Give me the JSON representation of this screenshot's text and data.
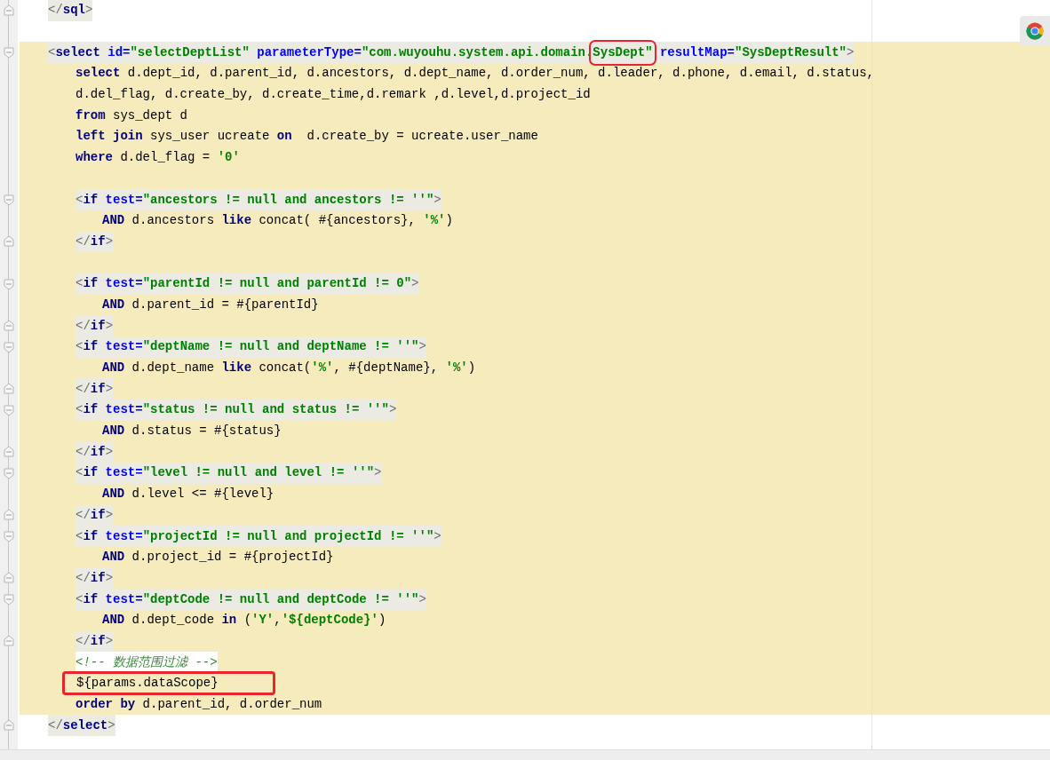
{
  "prev_block_close": {
    "tokens": [
      {
        "kind": "bracket",
        "t": "</"
      },
      {
        "kind": "tag",
        "t": "sql"
      },
      {
        "kind": "bracket",
        "t": ">"
      }
    ]
  },
  "select_block": {
    "open": {
      "tokens": [
        {
          "kind": "bracket",
          "t": "<"
        },
        {
          "kind": "tag",
          "t": "select"
        },
        {
          "kind": "attr",
          "t": " id="
        },
        {
          "kind": "value",
          "t": "\"selectDeptList\""
        },
        {
          "kind": "attr",
          "t": " parameterType="
        },
        {
          "kind": "value",
          "t": "\"com.wuyouhu.system.api.domain."
        },
        {
          "kind": "value",
          "t": "SysDept\"",
          "highlight": true
        },
        {
          "kind": "attr",
          "t": " resultMap="
        },
        {
          "kind": "value",
          "t": "\"SysDeptResult\""
        },
        {
          "kind": "bracket",
          "t": ">"
        }
      ]
    },
    "body": [
      {
        "kind": "line",
        "tokens": [
          {
            "kind": "keyword",
            "t": "select"
          },
          {
            "kind": "plain",
            "t": " d.dept_id, d.parent_id, d.ancestors, d.dept_name, d.order_num, d.leader, d.phone, d.email, d.status,"
          }
        ]
      },
      {
        "kind": "line",
        "tokens": [
          {
            "kind": "plain",
            "t": "d.del_flag, d.create_by, d.create_time,d.remark ,d.level,d.project_id"
          }
        ]
      },
      {
        "kind": "line",
        "tokens": [
          {
            "kind": "keyword",
            "t": "from"
          },
          {
            "kind": "plain",
            "t": " sys_dept d"
          }
        ]
      },
      {
        "kind": "line",
        "tokens": [
          {
            "kind": "keyword",
            "t": "left join"
          },
          {
            "kind": "plain",
            "t": " sys_user ucreate "
          },
          {
            "kind": "keyword",
            "t": "on"
          },
          {
            "kind": "plain",
            "t": "  d.create_by = ucreate.user_name"
          }
        ]
      },
      {
        "kind": "line",
        "tokens": [
          {
            "kind": "keyword",
            "t": "where"
          },
          {
            "kind": "plain",
            "t": " d.del_flag = "
          },
          {
            "kind": "literal",
            "t": "'0'"
          }
        ]
      },
      {
        "kind": "blank"
      },
      {
        "kind": "if",
        "open": [
          {
            "kind": "bracket",
            "t": "<"
          },
          {
            "kind": "tag",
            "t": "if"
          },
          {
            "kind": "attr",
            "t": " test="
          },
          {
            "kind": "value",
            "t": "\"ancestors != null and ancestors != ''\""
          },
          {
            "kind": "bracket",
            "t": ">"
          }
        ],
        "body": [
          {
            "kind": "line",
            "tokens": [
              {
                "kind": "keyword",
                "t": "AND"
              },
              {
                "kind": "plain",
                "t": " d.ancestors "
              },
              {
                "kind": "keyword",
                "t": "like"
              },
              {
                "kind": "plain",
                "t": " concat( #{ancestors}, "
              },
              {
                "kind": "literal",
                "t": "'%'"
              },
              {
                "kind": "plain",
                "t": ")"
              }
            ]
          }
        ],
        "close": [
          {
            "kind": "bracket",
            "t": "</"
          },
          {
            "kind": "tag",
            "t": "if"
          },
          {
            "kind": "bracket",
            "t": ">"
          }
        ]
      },
      {
        "kind": "blank"
      },
      {
        "kind": "if",
        "open": [
          {
            "kind": "bracket",
            "t": "<"
          },
          {
            "kind": "tag",
            "t": "if"
          },
          {
            "kind": "attr",
            "t": " test="
          },
          {
            "kind": "value",
            "t": "\"parentId != null and parentId != 0\""
          },
          {
            "kind": "bracket",
            "t": ">"
          }
        ],
        "body": [
          {
            "kind": "line",
            "tokens": [
              {
                "kind": "keyword",
                "t": "AND"
              },
              {
                "kind": "plain",
                "t": " d.parent_id = #{parentId}"
              }
            ]
          }
        ],
        "close": [
          {
            "kind": "bracket",
            "t": "</"
          },
          {
            "kind": "tag",
            "t": "if"
          },
          {
            "kind": "bracket",
            "t": ">"
          }
        ]
      },
      {
        "kind": "if",
        "open": [
          {
            "kind": "bracket",
            "t": "<"
          },
          {
            "kind": "tag",
            "t": "if"
          },
          {
            "kind": "attr",
            "t": " test="
          },
          {
            "kind": "value",
            "t": "\"deptName != null and deptName != ''\""
          },
          {
            "kind": "bracket",
            "t": ">"
          }
        ],
        "body": [
          {
            "kind": "line",
            "tokens": [
              {
                "kind": "keyword",
                "t": "AND"
              },
              {
                "kind": "plain",
                "t": " d.dept_name "
              },
              {
                "kind": "keyword",
                "t": "like"
              },
              {
                "kind": "plain",
                "t": " concat("
              },
              {
                "kind": "literal",
                "t": "'%'"
              },
              {
                "kind": "plain",
                "t": ", #{deptName}, "
              },
              {
                "kind": "literal",
                "t": "'%'"
              },
              {
                "kind": "plain",
                "t": ")"
              }
            ]
          }
        ],
        "close": [
          {
            "kind": "bracket",
            "t": "</"
          },
          {
            "kind": "tag",
            "t": "if"
          },
          {
            "kind": "bracket",
            "t": ">"
          }
        ]
      },
      {
        "kind": "if",
        "open": [
          {
            "kind": "bracket",
            "t": "<"
          },
          {
            "kind": "tag",
            "t": "if"
          },
          {
            "kind": "attr",
            "t": " test="
          },
          {
            "kind": "value",
            "t": "\"status != null and status != ''\""
          },
          {
            "kind": "bracket",
            "t": ">"
          }
        ],
        "body": [
          {
            "kind": "line",
            "tokens": [
              {
                "kind": "keyword",
                "t": "AND"
              },
              {
                "kind": "plain",
                "t": " d.status = #{status}"
              }
            ]
          }
        ],
        "close": [
          {
            "kind": "bracket",
            "t": "</"
          },
          {
            "kind": "tag",
            "t": "if"
          },
          {
            "kind": "bracket",
            "t": ">"
          }
        ]
      },
      {
        "kind": "if",
        "open": [
          {
            "kind": "bracket",
            "t": "<"
          },
          {
            "kind": "tag",
            "t": "if"
          },
          {
            "kind": "attr",
            "t": " test="
          },
          {
            "kind": "value",
            "t": "\"level != null and level != ''\""
          },
          {
            "kind": "bracket",
            "t": ">"
          }
        ],
        "body": [
          {
            "kind": "line",
            "tokens": [
              {
                "kind": "keyword",
                "t": "AND"
              },
              {
                "kind": "plain",
                "t": " d.level <= #{level}"
              }
            ]
          }
        ],
        "close": [
          {
            "kind": "bracket",
            "t": "</"
          },
          {
            "kind": "tag",
            "t": "if"
          },
          {
            "kind": "bracket",
            "t": ">"
          }
        ]
      },
      {
        "kind": "if",
        "open": [
          {
            "kind": "bracket",
            "t": "<"
          },
          {
            "kind": "tag",
            "t": "if"
          },
          {
            "kind": "attr",
            "t": " test="
          },
          {
            "kind": "value",
            "t": "\"projectId != null and projectId != ''\""
          },
          {
            "kind": "bracket",
            "t": ">"
          }
        ],
        "body": [
          {
            "kind": "line",
            "tokens": [
              {
                "kind": "keyword",
                "t": "AND"
              },
              {
                "kind": "plain",
                "t": " d.project_id = #{projectId}"
              }
            ]
          }
        ],
        "close": [
          {
            "kind": "bracket",
            "t": "</"
          },
          {
            "kind": "tag",
            "t": "if"
          },
          {
            "kind": "bracket",
            "t": ">"
          }
        ]
      },
      {
        "kind": "if",
        "open": [
          {
            "kind": "bracket",
            "t": "<"
          },
          {
            "kind": "tag",
            "t": "if"
          },
          {
            "kind": "attr",
            "t": " test="
          },
          {
            "kind": "value",
            "t": "\"deptCode != null and deptCode != ''\""
          },
          {
            "kind": "bracket",
            "t": ">"
          }
        ],
        "body": [
          {
            "kind": "line",
            "tokens": [
              {
                "kind": "keyword",
                "t": "AND"
              },
              {
                "kind": "plain",
                "t": " d.dept_code "
              },
              {
                "kind": "keyword",
                "t": "in"
              },
              {
                "kind": "plain",
                "t": " ("
              },
              {
                "kind": "literal",
                "t": "'Y'"
              },
              {
                "kind": "plain",
                "t": ","
              },
              {
                "kind": "literal",
                "t": "'${deptCode}'"
              },
              {
                "kind": "plain",
                "t": ")"
              }
            ]
          }
        ],
        "close": [
          {
            "kind": "bracket",
            "t": "</"
          },
          {
            "kind": "tag",
            "t": "if"
          },
          {
            "kind": "bracket",
            "t": ">"
          }
        ]
      },
      {
        "kind": "comment",
        "text": "<!-- 数据范围过滤 -->"
      },
      {
        "kind": "line",
        "highlight": true,
        "tokens": [
          {
            "kind": "plain",
            "t": "${params.dataScope}"
          }
        ]
      },
      {
        "kind": "line",
        "tokens": [
          {
            "kind": "keyword",
            "t": "order by"
          },
          {
            "kind": "plain",
            "t": " d.parent_id, d.order_num"
          }
        ]
      }
    ],
    "close": {
      "tokens": [
        {
          "kind": "bracket",
          "t": "</"
        },
        {
          "kind": "tag",
          "t": "select"
        },
        {
          "kind": "bracket",
          "t": ">"
        }
      ]
    }
  }
}
